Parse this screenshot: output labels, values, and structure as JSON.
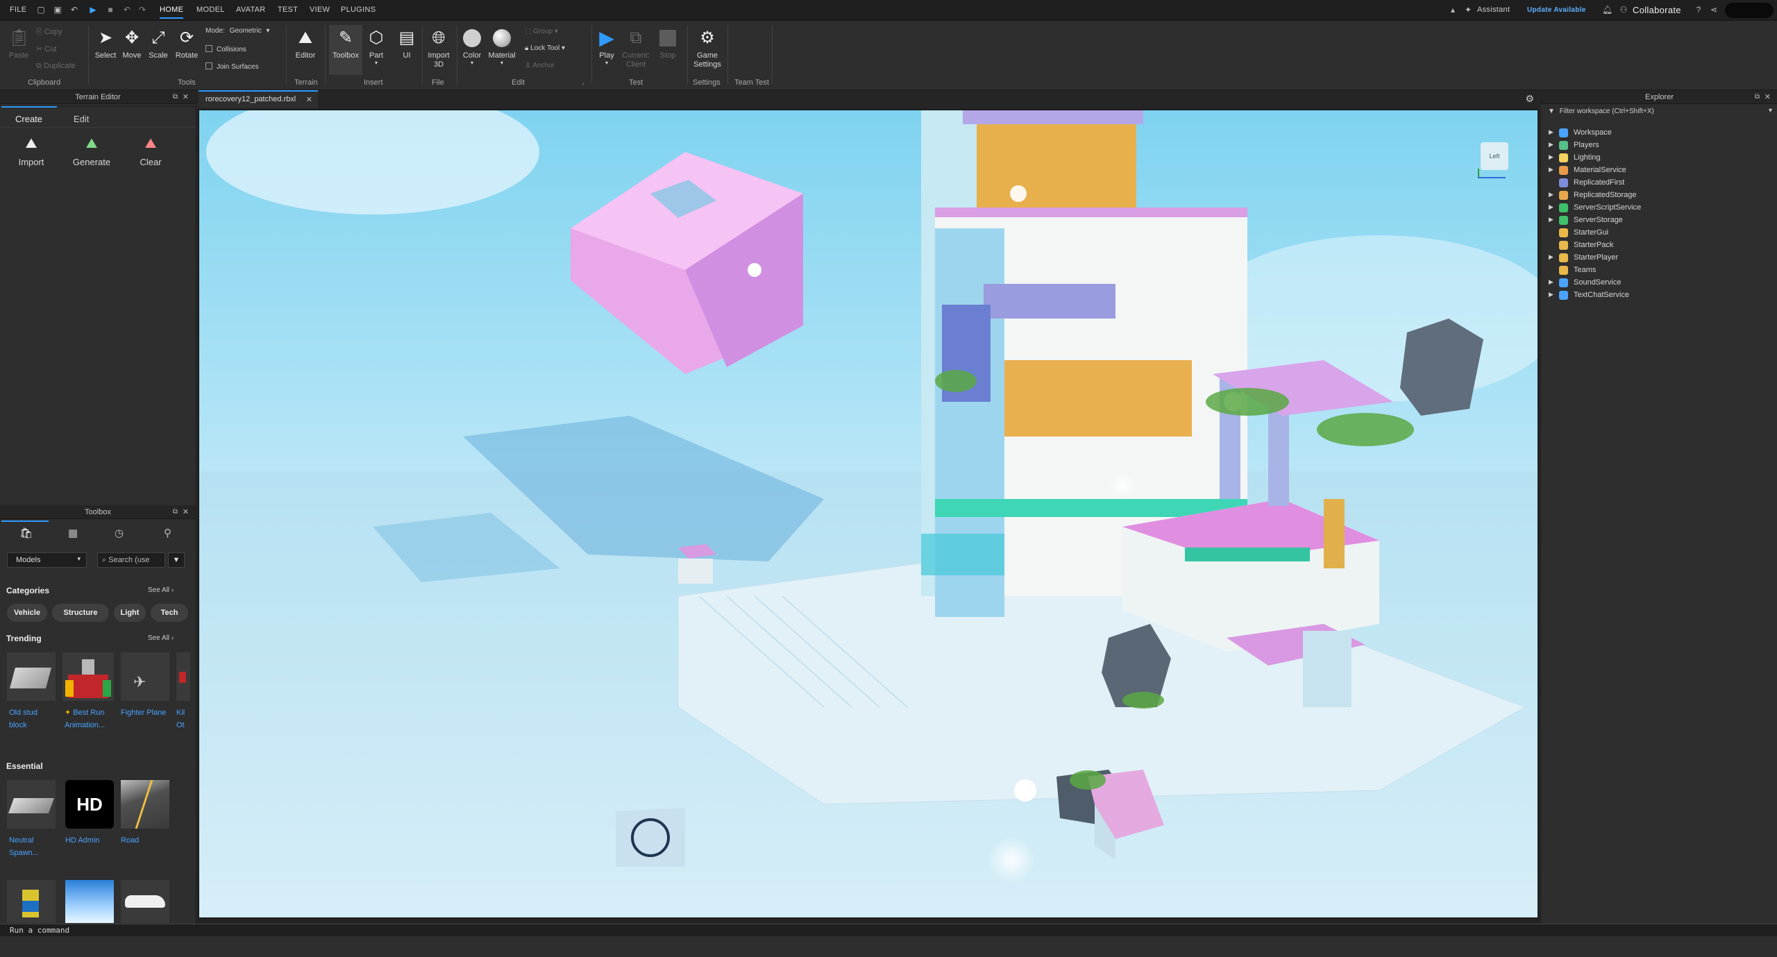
{
  "menubar": {
    "file": "FILE",
    "tabs": [
      "HOME",
      "MODEL",
      "AVATAR",
      "TEST",
      "VIEW",
      "PLUGINS"
    ],
    "assistant": "Assistant",
    "update": "Update Available",
    "collaborate": "Collaborate"
  },
  "ribbon": {
    "clipboard": {
      "paste": "Paste",
      "copy": "Copy",
      "cut": "Cut",
      "duplicate": "Duplicate",
      "group": "Clipboard"
    },
    "tools": {
      "select": "Select",
      "move": "Move",
      "scale": "Scale",
      "rotate": "Rotate",
      "mode_label": "Mode:",
      "mode_value": "Geometric",
      "collisions": "Collisions",
      "join_surfaces": "Join Surfaces",
      "group": "Tools"
    },
    "terrain": {
      "editor": "Editor",
      "group": "Terrain"
    },
    "insert": {
      "toolbox": "Toolbox",
      "part": "Part",
      "ui": "UI",
      "group": "Insert"
    },
    "file": {
      "import3d": "Import 3D",
      "group": "File"
    },
    "edit": {
      "color": "Color",
      "material": "Material",
      "group_btn": "Group",
      "lock_tool": "Lock Tool",
      "anchor": "Anchor",
      "group": "Edit"
    },
    "test": {
      "play": "Play",
      "current_client": "Current: Client",
      "stop": "Stop",
      "group": "Test"
    },
    "settings": {
      "game_settings": "Game Settings",
      "group": "Settings"
    },
    "team_test": {
      "group": "Team Test"
    }
  },
  "terrain_editor": {
    "title": "Terrain Editor",
    "tabs": [
      "Create",
      "Edit"
    ],
    "actions": [
      "Import",
      "Generate",
      "Clear"
    ]
  },
  "document_tab": "rorecovery12_patched.rbxl",
  "toolbox": {
    "title": "Toolbox",
    "dropdown": "Models",
    "search_placeholder": "Search (use",
    "categories_title": "Categories",
    "see_all": "See All",
    "categories": [
      "Vehicle",
      "Structure",
      "Light",
      "Tech"
    ],
    "trending_title": "Trending",
    "trending": [
      "Old stud block",
      "Best Run Animation...",
      "Fighter Plane",
      "Kil Ot"
    ],
    "essential_title": "Essential",
    "essential": [
      "Neutral Spawn...",
      "HD Admin",
      "Road"
    ]
  },
  "viewcube_face": "Left",
  "explorer": {
    "title": "Explorer",
    "filter_placeholder": "Filter workspace (Ctrl+Shift+X)",
    "items": [
      {
        "label": "Workspace",
        "expandable": true,
        "icon_color": "#4aa3ff"
      },
      {
        "label": "Players",
        "expandable": true,
        "icon_color": "#57c08a"
      },
      {
        "label": "Lighting",
        "expandable": true,
        "icon_color": "#f4d35e"
      },
      {
        "label": "MaterialService",
        "expandable": true,
        "icon_color": "#e89b4a"
      },
      {
        "label": "ReplicatedFirst",
        "expandable": false,
        "icon_color": "#7d8cd8"
      },
      {
        "label": "ReplicatedStorage",
        "expandable": true,
        "icon_color": "#e8a64a"
      },
      {
        "label": "ServerScriptService",
        "expandable": true,
        "icon_color": "#3fbf6b"
      },
      {
        "label": "ServerStorage",
        "expandable": true,
        "icon_color": "#3fbf6b"
      },
      {
        "label": "StarterGui",
        "expandable": false,
        "icon_color": "#e8b84a"
      },
      {
        "label": "StarterPack",
        "expandable": false,
        "icon_color": "#e8b84a"
      },
      {
        "label": "StarterPlayer",
        "expandable": true,
        "icon_color": "#e8b84a"
      },
      {
        "label": "Teams",
        "expandable": false,
        "icon_color": "#e8b84a"
      },
      {
        "label": "SoundService",
        "expandable": true,
        "icon_color": "#4aa3ff"
      },
      {
        "label": "TextChatService",
        "expandable": true,
        "icon_color": "#4aa3ff"
      }
    ]
  },
  "command_bar": {
    "placeholder": "Run a command"
  }
}
